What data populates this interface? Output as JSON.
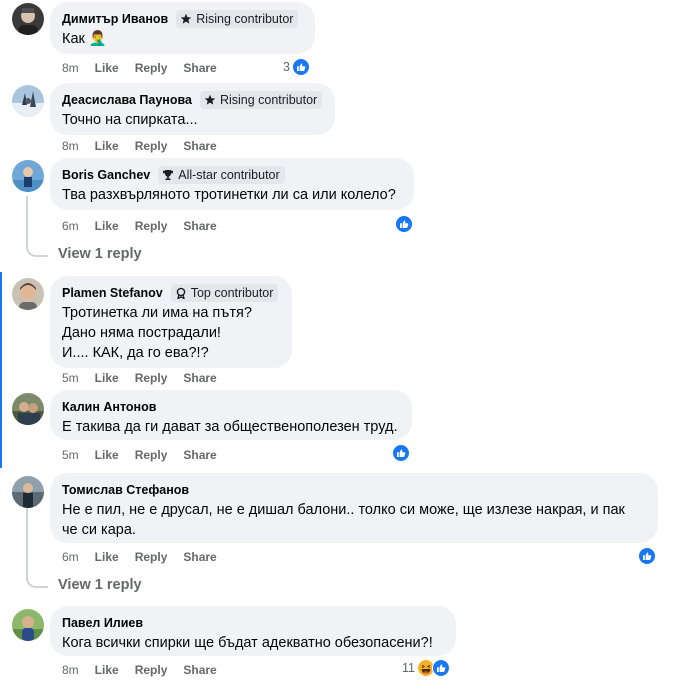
{
  "comments": [
    {
      "author": "Димитър Иванов",
      "badge": "Rising contributor",
      "badge_icon": "star-icon",
      "lines": [
        "Как 🤦‍♂️"
      ],
      "time": "8m",
      "like": "Like",
      "reply": "Reply",
      "share": "Share",
      "reaction_count": "3",
      "reactions": [
        "like-icon"
      ]
    },
    {
      "author": "Деасислава Паунова",
      "badge": "Rising contributor",
      "badge_icon": "star-icon",
      "lines": [
        "Точно на спирката..."
      ],
      "time": "8m",
      "like": "Like",
      "reply": "Reply",
      "share": "Share",
      "reaction_count": "",
      "reactions": []
    },
    {
      "author": "Boris Ganchev",
      "badge": "All-star contributor",
      "badge_icon": "trophy-icon",
      "lines": [
        "Тва разхвърляното тротинетки ли са или колело?"
      ],
      "time": "6m",
      "like": "Like",
      "reply": "Reply",
      "share": "Share",
      "reaction_count": "",
      "reactions": [
        "like-icon"
      ],
      "view_replies": "View 1 reply"
    },
    {
      "author": "Plamen Stefanov",
      "badge": "Top contributor",
      "badge_icon": "medal-icon",
      "lines": [
        "Тротинетка ли има на пътя?",
        "Дано няма пострадали!",
        "И.... КАК, да го ева?!?"
      ],
      "time": "5m",
      "like": "Like",
      "reply": "Reply",
      "share": "Share",
      "reaction_count": "",
      "reactions": []
    },
    {
      "author": "Калин Антонов",
      "badge": "",
      "lines": [
        "Е такива да ги дават за общественополезен труд."
      ],
      "time": "5m",
      "like": "Like",
      "reply": "Reply",
      "share": "Share",
      "reaction_count": "",
      "reactions": [
        "like-icon"
      ]
    },
    {
      "author": "Томислав Стефанов",
      "badge": "",
      "lines": [
        "Не е пил, не е друсал, не е дишал балони.. толко си може, ще излезе накрая, и пак",
        "че си кара."
      ],
      "time": "6m",
      "like": "Like",
      "reply": "Reply",
      "share": "Share",
      "reaction_count": "",
      "reactions": [
        "like-icon"
      ],
      "view_replies": "View 1 reply"
    },
    {
      "author": "Павел Илиев",
      "badge": "",
      "lines": [
        "Кога всички спирки ще бъдат адекватно обезопасени?!"
      ],
      "time": "8m",
      "like": "Like",
      "reply": "Reply",
      "share": "Share",
      "reaction_count": "11",
      "reactions": [
        "haha-icon",
        "like-icon"
      ]
    }
  ],
  "colors": {
    "accent": "#1877f2",
    "bubble": "#f0f2f5",
    "meta": "#65676b",
    "badge_bg": "#e4e6eb",
    "haha": "#f7b125"
  }
}
